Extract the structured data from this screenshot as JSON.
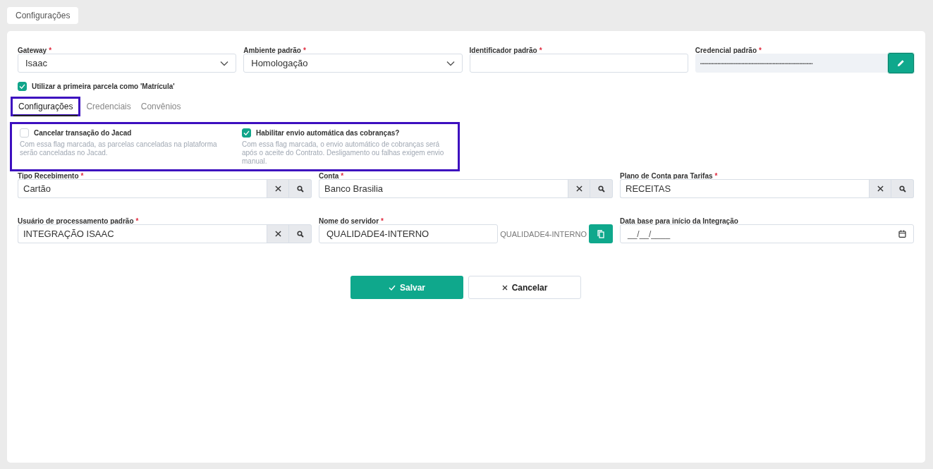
{
  "page_tab": {
    "label": "Configurações"
  },
  "top_fields": [
    {
      "kind": "select",
      "label": "Gateway",
      "mark": "*",
      "value": "Isaac"
    },
    {
      "kind": "select",
      "label": "Ambiente padrão",
      "mark": "*",
      "value": "Homologação"
    },
    {
      "kind": "text",
      "label": "Identificador padrão",
      "mark": "*"
    },
    {
      "kind": "secret",
      "label": "Credencial padrão",
      "mark": "*",
      "value": "••••••••••••••••••••••••••••••••••••••••••••••••••••••••••••••••••••••••••••••••••••"
    }
  ],
  "first_installment": {
    "label": "Utilizar a primeira parcela como 'Matrícula'",
    "checked": true
  },
  "tabs": [
    {
      "label": "Configurações",
      "selected": true,
      "highlighted": true
    },
    {
      "label": "Credenciais",
      "selected": false,
      "highlighted": false
    },
    {
      "label": "Convênios",
      "selected": false,
      "highlighted": false
    }
  ],
  "options": {
    "highlighted": true,
    "items": [
      {
        "label": "Cancelar transação do Jacad",
        "description": "Com essa flag marcada, as parcelas canceladas na plataforma serão canceladas no Jacad.",
        "checked": false
      },
      {
        "label": "Habilitar envio automática das cobranças?",
        "description": "Com essa flag marcada, o envio automático de cobranças será após o aceite do Contrato. Desligamento ou falhas exigem envio manual.",
        "checked": true
      }
    ]
  },
  "fields": [
    {
      "kind": "lookup",
      "label": "Tipo Recebimento",
      "mark": "*",
      "value": "Cartão"
    },
    {
      "kind": "lookup",
      "label": "Conta",
      "mark": "*",
      "value": "Banco Brasilia"
    },
    {
      "kind": "lookup",
      "label": "Plano de Conta para Tarifas",
      "mark": "*",
      "value": "RECEITAS"
    },
    {
      "kind": "lookup",
      "label": "Usuário de processamento padrão",
      "mark": "*",
      "value": "INTEGRAÇÃO ISAAC"
    },
    {
      "kind": "server",
      "label": "Nome do servidor",
      "mark": "*",
      "value": "QUALIDADE4-INTERNO",
      "echo": "QUALIDADE4-INTERNO"
    },
    {
      "kind": "date",
      "label": "Data base para início da Integração",
      "placeholder": "__/__/____"
    }
  ],
  "buttons": [
    {
      "kind": "primary",
      "label": "Salvar"
    },
    {
      "kind": "secondary",
      "label": "Cancelar"
    }
  ]
}
